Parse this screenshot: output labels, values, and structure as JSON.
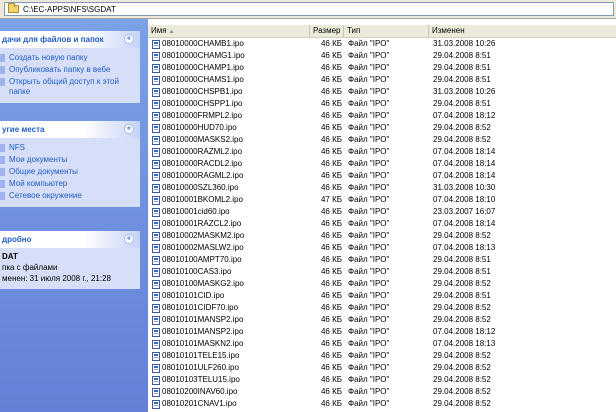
{
  "address": {
    "path": "C:\\EC-APPS\\NFS\\SGDAT"
  },
  "sidebar": {
    "tasks": {
      "title": "дачи для файлов и папок",
      "items": [
        "Создать новую папку",
        "Опубликовать папку в вебе",
        "Открыть общий доступ к этой папке"
      ]
    },
    "places": {
      "title": "угие места",
      "items": [
        "NFS",
        "Мои документы",
        "Общие документы",
        "Мой компьютер",
        "Сетевое окружение"
      ]
    },
    "details": {
      "title": "дробно",
      "name": "DAT",
      "kind": "пка с файлами",
      "modified": "менен: 31 июля 2008 г., 21:28"
    }
  },
  "columns": {
    "name": "Имя",
    "size": "Размер",
    "type": "Тип",
    "date": "Изменен"
  },
  "files": [
    {
      "name": "08010000CHAMB1.ipo",
      "size": "46 КБ",
      "type": "Файл \"IPO\"",
      "date": "31.03.2008 10:26"
    },
    {
      "name": "08010000CHAMG1.ipo",
      "size": "46 КБ",
      "type": "Файл \"IPO\"",
      "date": "29.04.2008 8:51"
    },
    {
      "name": "08010000CHAMP1.ipo",
      "size": "46 КБ",
      "type": "Файл \"IPO\"",
      "date": "29.04.2008 8:51"
    },
    {
      "name": "08010000CHAMS1.ipo",
      "size": "46 КБ",
      "type": "Файл \"IPO\"",
      "date": "29.04.2008 8:51"
    },
    {
      "name": "08010000CHSPB1.ipo",
      "size": "46 КБ",
      "type": "Файл \"IPO\"",
      "date": "31.03.2008 10:26"
    },
    {
      "name": "08010000CHSPP1.ipo",
      "size": "46 КБ",
      "type": "Файл \"IPO\"",
      "date": "29.04.2008 8:51"
    },
    {
      "name": "08010000FRMPL2.ipo",
      "size": "46 КБ",
      "type": "Файл \"IPO\"",
      "date": "07.04.2008 18:12"
    },
    {
      "name": "08010000HUD70.ipo",
      "size": "46 КБ",
      "type": "Файл \"IPO\"",
      "date": "29.04.2008 8:52"
    },
    {
      "name": "08010000MASKS2.ipo",
      "size": "46 КБ",
      "type": "Файл \"IPO\"",
      "date": "29.04.2008 8:52"
    },
    {
      "name": "08010000RAZML2.ipo",
      "size": "46 КБ",
      "type": "Файл \"IPO\"",
      "date": "07.04.2008 18:14"
    },
    {
      "name": "08010000RACDL2.ipo",
      "size": "46 КБ",
      "type": "Файл \"IPO\"",
      "date": "07.04.2008 18:14"
    },
    {
      "name": "08010000RAGML2.ipo",
      "size": "46 КБ",
      "type": "Файл \"IPO\"",
      "date": "07.04.2008 18:14"
    },
    {
      "name": "08010000SZL360.ipo",
      "size": "46 КБ",
      "type": "Файл \"IPO\"",
      "date": "31.03.2008 10:30"
    },
    {
      "name": "08010001BKOML2.ipo",
      "size": "47 КБ",
      "type": "Файл \"IPO\"",
      "date": "07.04.2008 18:10"
    },
    {
      "name": "08010001cid60.ipo",
      "size": "46 КБ",
      "type": "Файл \"IPO\"",
      "date": "23.03.2007 16:07"
    },
    {
      "name": "08010001RAZCL2.ipo",
      "size": "46 КБ",
      "type": "Файл \"IPO\"",
      "date": "07.04.2008 18:14"
    },
    {
      "name": "08010002MASKM2.ipo",
      "size": "46 КБ",
      "type": "Файл \"IPO\"",
      "date": "29.04.2008 8:52"
    },
    {
      "name": "08010002MASLW2.ipo",
      "size": "46 КБ",
      "type": "Файл \"IPO\"",
      "date": "07.04.2008 18:13"
    },
    {
      "name": "08010100AMPT70.ipo",
      "size": "46 КБ",
      "type": "Файл \"IPO\"",
      "date": "29.04.2008 8:51"
    },
    {
      "name": "08010100CAS3.ipo",
      "size": "46 КБ",
      "type": "Файл \"IPO\"",
      "date": "29.04.2008 8:51"
    },
    {
      "name": "08010100MASKG2.ipo",
      "size": "46 КБ",
      "type": "Файл \"IPO\"",
      "date": "29.04.2008 8:52"
    },
    {
      "name": "08010101CID.ipo",
      "size": "46 КБ",
      "type": "Файл \"IPO\"",
      "date": "29.04.2008 8:51"
    },
    {
      "name": "08010101CIDF70.ipo",
      "size": "46 КБ",
      "type": "Файл \"IPO\"",
      "date": "29.04.2008 8:52"
    },
    {
      "name": "08010101MANSP2.ipo",
      "size": "46 КБ",
      "type": "Файл \"IPO\"",
      "date": "29.04.2008 8:52"
    },
    {
      "name": "08010101MANSP2.ipo",
      "size": "46 КБ",
      "type": "Файл \"IPO\"",
      "date": "07.04.2008 18:12"
    },
    {
      "name": "08010101MASKN2.ipo",
      "size": "46 КБ",
      "type": "Файл \"IPO\"",
      "date": "07.04.2008 18:13"
    },
    {
      "name": "08010101TELE15.ipo",
      "size": "46 КБ",
      "type": "Файл \"IPO\"",
      "date": "29.04.2008 8:52"
    },
    {
      "name": "08010101ULF260.ipo",
      "size": "46 КБ",
      "type": "Файл \"IPO\"",
      "date": "29.04.2008 8:52"
    },
    {
      "name": "08010103TELU15.ipo",
      "size": "46 КБ",
      "type": "Файл \"IPO\"",
      "date": "29.04.2008 8:52"
    },
    {
      "name": "08010200INAV60.ipo",
      "size": "46 КБ",
      "type": "Файл \"IPO\"",
      "date": "29.04.2008 8:52"
    },
    {
      "name": "08010201CNAV1.ipo",
      "size": "46 КБ",
      "type": "Файл \"IPO\"",
      "date": "29.04.2008 8:52"
    }
  ]
}
